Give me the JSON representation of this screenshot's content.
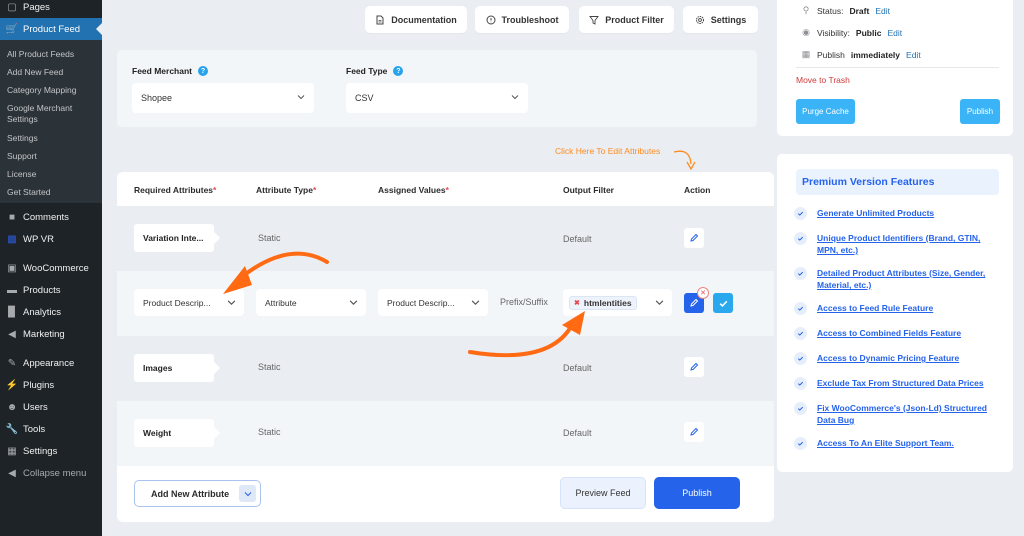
{
  "sidebar": {
    "items": [
      {
        "label": "Pages",
        "icon": "pages-icon"
      },
      {
        "label": "Product Feed",
        "icon": "cart-icon",
        "active": true
      },
      {
        "label": "Comments",
        "icon": "comment-icon"
      },
      {
        "label": "WP VR",
        "icon": "vr-icon"
      },
      {
        "label": "WooCommerce",
        "icon": "woo-icon"
      },
      {
        "label": "Products",
        "icon": "archive-icon"
      },
      {
        "label": "Analytics",
        "icon": "bar-chart-icon"
      },
      {
        "label": "Marketing",
        "icon": "megaphone-icon"
      },
      {
        "label": "Appearance",
        "icon": "brush-icon"
      },
      {
        "label": "Plugins",
        "icon": "plug-icon"
      },
      {
        "label": "Users",
        "icon": "user-icon"
      },
      {
        "label": "Tools",
        "icon": "wrench-icon"
      },
      {
        "label": "Settings",
        "icon": "settings-icon"
      },
      {
        "label": "Collapse menu",
        "icon": "collapse-icon"
      }
    ],
    "submenu": [
      "All Product Feeds",
      "Add New Feed",
      "Category Mapping",
      "Google Merchant Settings",
      "Settings",
      "Support",
      "License",
      "Get Started"
    ]
  },
  "toolbar": {
    "documentation": "Documentation",
    "troubleshoot": "Troubleshoot",
    "product_filter": "Product Filter",
    "settings": "Settings"
  },
  "feed": {
    "merchant_label": "Feed Merchant",
    "merchant_value": "Shopee",
    "type_label": "Feed Type",
    "type_value": "CSV",
    "help_glyph": "?"
  },
  "hint": "Click Here To Edit Attributes",
  "table": {
    "headers": {
      "required": "Required Attributes",
      "type": "Attribute Type",
      "assigned": "Assigned Values",
      "output": "Output Filter",
      "action": "Action",
      "req_mark": "*"
    },
    "rows": [
      {
        "attribute": "Variation Inte...",
        "type": "Static",
        "output": "Default"
      },
      {
        "attribute": "Product Descrip...",
        "type": "Attribute",
        "assigned": "Product Descrip...",
        "prefix": "Prefix/Suffix",
        "filter_chip": "htmlentities",
        "editing": true
      },
      {
        "attribute": "Images",
        "type": "Static",
        "output": "Default"
      },
      {
        "attribute": "Weight",
        "type": "Static",
        "output": "Default"
      }
    ],
    "add_attribute": "Add New Attribute",
    "preview": "Preview Feed",
    "publish": "Publish"
  },
  "publish_box": {
    "status_label": "Status:",
    "status_value": "Draft",
    "visibility_label": "Visibility:",
    "visibility_value": "Public",
    "publish_label": "Publish",
    "publish_value": "immediately",
    "edit": "Edit",
    "trash": "Move to Trash",
    "purge": "Purge Cache",
    "publish": "Publish"
  },
  "premium": {
    "title": "Premium Version Features",
    "features": [
      "Generate Unlimited Products",
      "Unique Product Identifiers (Brand, GTIN, MPN, etc.)",
      "Detailed Product Attributes (Size, Gender, Material, etc.)",
      "Access to Feed Rule Feature",
      "Access to Combined Fields Feature",
      "Access to Dynamic Pricing Feature",
      "Exclude Tax From Structured Data Prices",
      "Fix WooCommerce's (Json-Ld) Structured Data Bug",
      "Access To An Elite Support Team."
    ]
  },
  "colors": {
    "accent": "#2563eb",
    "sidebar_bg": "#1d2327",
    "sidebar_active": "#2271b1",
    "annotation_orange": "#ff6a13",
    "light_blue_button": "#3ab4f7"
  }
}
